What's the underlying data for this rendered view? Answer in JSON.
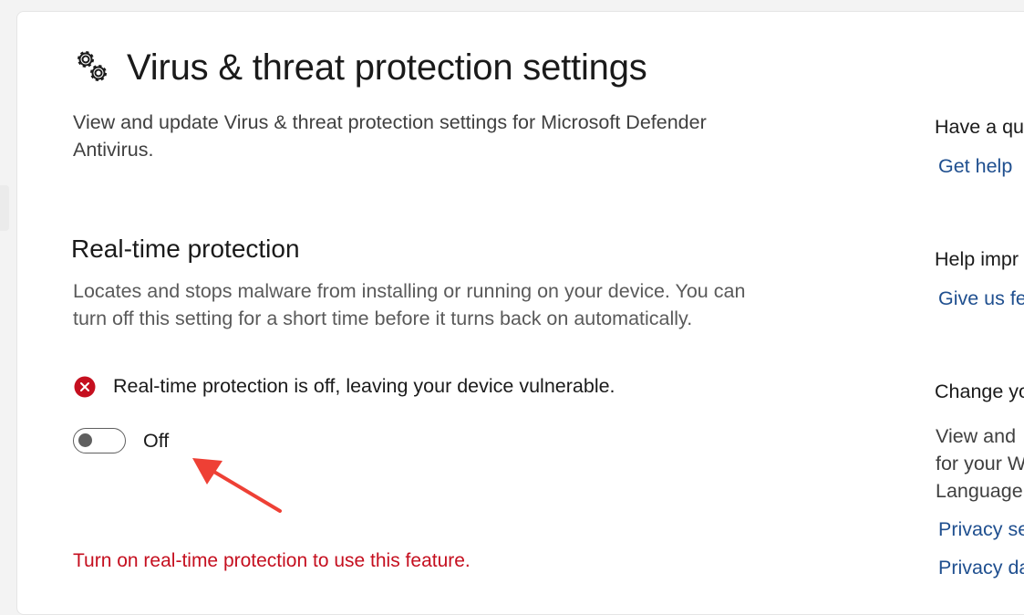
{
  "page": {
    "title": "Virus & threat protection settings",
    "description": "View and update Virus & threat protection settings for Microsoft Defender Antivirus."
  },
  "realtime": {
    "title": "Real-time protection",
    "description": "Locates and stops malware from installing or running on your device. You can turn off this setting for a short time before it turns back on automatically.",
    "warning": "Real-time protection is off, leaving your device vulnerable.",
    "toggle_state": "Off",
    "feature_error": "Turn on real-time protection to use this feature."
  },
  "sidebar_right": {
    "question_heading": "Have a qu",
    "get_help_link": "Get help",
    "improve_heading": "Help impr",
    "feedback_link": "Give us fee",
    "change_heading": "Change yo",
    "change_text_line1": "View and",
    "change_text_line2": "for your W",
    "change_text_line3": "Language",
    "privacy_settings_link": "Privacy set",
    "privacy_dashboard_link": "Privacy das"
  },
  "icons": {
    "title_icon": "gears-icon",
    "warning_icon": "error-x-icon",
    "annotation": "red-arrow"
  },
  "colors": {
    "error_red": "#c50f1f",
    "link_blue": "#1f4f8f",
    "annotation_arrow": "#ee4035"
  }
}
